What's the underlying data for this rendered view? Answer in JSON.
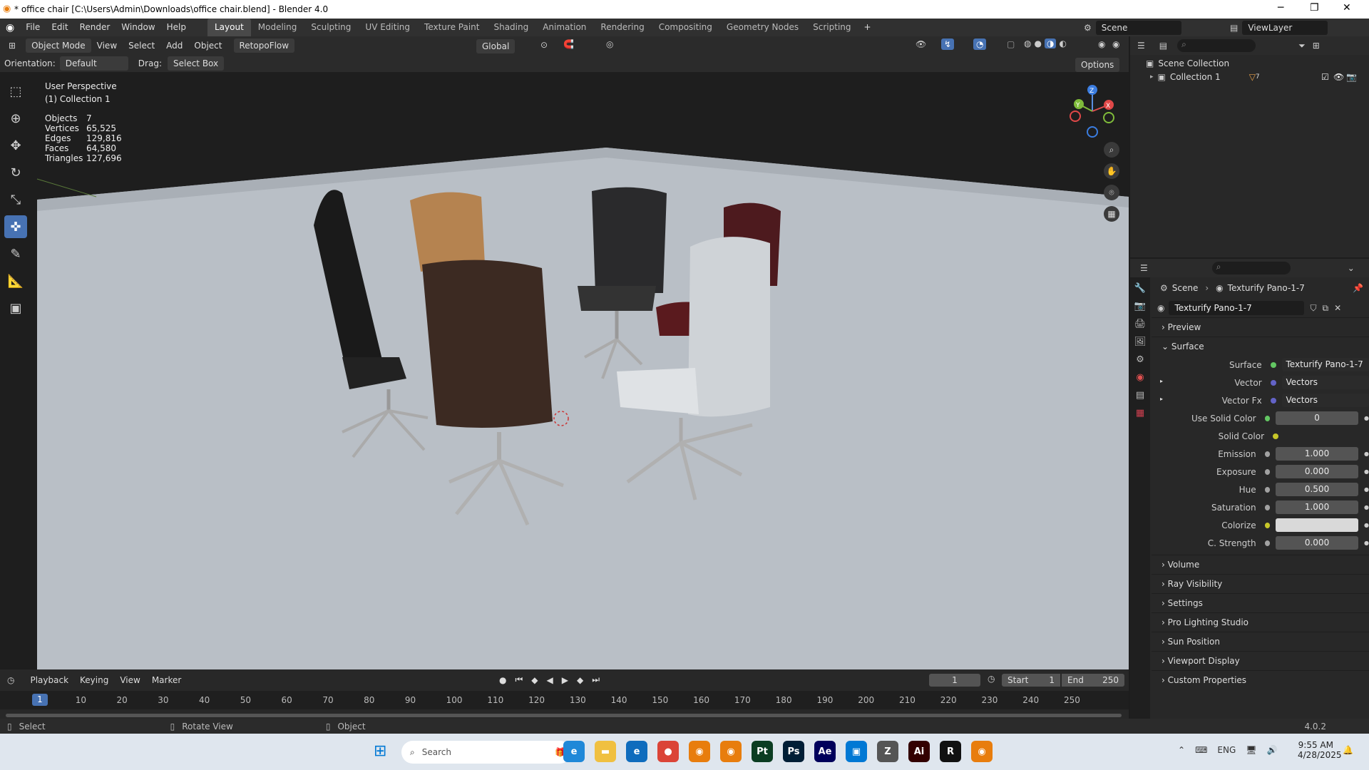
{
  "window": {
    "title": "* office chair [C:\\Users\\Admin\\Downloads\\office chair.blend] - Blender 4.0",
    "minimize": "─",
    "maximize": "❐",
    "close": "✕"
  },
  "menu": [
    "File",
    "Edit",
    "Render",
    "Window",
    "Help"
  ],
  "workspaces": [
    "Layout",
    "Modeling",
    "Sculpting",
    "UV Editing",
    "Texture Paint",
    "Shading",
    "Animation",
    "Rendering",
    "Compositing",
    "Geometry Nodes",
    "Scripting"
  ],
  "scene_name": "Scene",
  "view_layer": "ViewLayer",
  "viewport_header": {
    "mode": "Object Mode",
    "view": "View",
    "select": "Select",
    "add": "Add",
    "object": "Object",
    "addon": "RetopoFlow",
    "transform": "Global"
  },
  "tool_settings": {
    "orientation_label": "Orientation:",
    "orientation": "Default",
    "drag_label": "Drag:",
    "drag": "Select Box",
    "options": "Options"
  },
  "overlay": {
    "view_name": "User Perspective",
    "collection": "(1) Collection 1"
  },
  "stats": [
    {
      "label": "Objects",
      "value": "7"
    },
    {
      "label": "Vertices",
      "value": "65,525"
    },
    {
      "label": "Edges",
      "value": "129,816"
    },
    {
      "label": "Faces",
      "value": "64,580"
    },
    {
      "label": "Triangles",
      "value": "127,696"
    }
  ],
  "gizmo": {
    "z": "Z",
    "y": "Y",
    "x": "X"
  },
  "outliner": {
    "root": "Scene Collection",
    "collection": "Collection 1",
    "count": "7"
  },
  "properties": {
    "breadcrumb_scene": "Scene",
    "breadcrumb_world": "Texturify Pano-1-7",
    "world_name": "Texturify Pano-1-7",
    "panels_top": [
      "Preview",
      "Surface"
    ],
    "rows": [
      {
        "label": "Surface",
        "value": "Texturify Pano-1-7",
        "sock": "#63c763",
        "kind": "link"
      },
      {
        "label": "Vector",
        "value": "Vectors",
        "sock": "#6363c7",
        "kind": "link",
        "expand": true
      },
      {
        "label": "Vector Fx",
        "value": "Vectors",
        "sock": "#6363c7",
        "kind": "link",
        "expand": true
      },
      {
        "label": "Use Solid Color",
        "value": "0",
        "sock": "#63c763",
        "kind": "num"
      },
      {
        "label": "Solid Color",
        "value": "",
        "sock": "#c7c729",
        "kind": "none"
      },
      {
        "label": "Emission",
        "value": "1.000",
        "sock": "#a1a1a1",
        "kind": "num"
      },
      {
        "label": "Exposure",
        "value": "0.000",
        "sock": "#a1a1a1",
        "kind": "num"
      },
      {
        "label": "Hue",
        "value": "0.500",
        "sock": "#a1a1a1",
        "kind": "num"
      },
      {
        "label": "Saturation",
        "value": "1.000",
        "sock": "#a1a1a1",
        "kind": "num"
      },
      {
        "label": "Colorize",
        "value": "",
        "sock": "#c7c729",
        "kind": "color"
      },
      {
        "label": "C. Strength",
        "value": "0.000",
        "sock": "#a1a1a1",
        "kind": "num"
      }
    ],
    "panels_bottom": [
      "Volume",
      "Ray Visibility",
      "Settings",
      "Pro Lighting Studio",
      "Sun Position",
      "Viewport Display",
      "Custom Properties"
    ]
  },
  "timeline": {
    "playback": "Playback",
    "keying": "Keying",
    "view": "View",
    "marker": "Marker",
    "current_frame": "1",
    "start_label": "Start",
    "start": "1",
    "end_label": "End",
    "end": "250",
    "ticks": [
      "1",
      "10",
      "20",
      "30",
      "40",
      "50",
      "60",
      "70",
      "80",
      "90",
      "100",
      "110",
      "120",
      "130",
      "140",
      "150",
      "160",
      "170",
      "180",
      "190",
      "200",
      "210",
      "220",
      "230",
      "240",
      "250"
    ]
  },
  "status": {
    "select": "Select",
    "rotate": "Rotate View",
    "object": "Object",
    "version": "4.0.2"
  },
  "taskbar": {
    "search": "Search",
    "lang": "ENG",
    "time": "9:55 AM",
    "date": "4/28/2025",
    "apps": [
      {
        "name": "edge",
        "label": "e",
        "color": "#1f88d8"
      },
      {
        "name": "explorer",
        "label": "▬",
        "color": "#f0c040"
      },
      {
        "name": "edge2",
        "label": "e",
        "color": "#0f6cbd"
      },
      {
        "name": "chrome",
        "label": "●",
        "color": "#db4437"
      },
      {
        "name": "blender1",
        "label": "◉",
        "color": "#e87d0d"
      },
      {
        "name": "blender2",
        "label": "◉",
        "color": "#e87d0d"
      },
      {
        "name": "painter",
        "label": "Pt",
        "color": "#0b3d22"
      },
      {
        "name": "photoshop",
        "label": "Ps",
        "color": "#001e36"
      },
      {
        "name": "aftereffects",
        "label": "Ae",
        "color": "#00005b"
      },
      {
        "name": "store",
        "label": "▣",
        "color": "#0078d4"
      },
      {
        "name": "zbrush",
        "label": "Z",
        "color": "#555555"
      },
      {
        "name": "illustrator",
        "label": "Ai",
        "color": "#330000"
      },
      {
        "name": "rizom",
        "label": "R",
        "color": "#111111"
      },
      {
        "name": "blender3",
        "label": "◉",
        "color": "#e87d0d"
      }
    ]
  }
}
